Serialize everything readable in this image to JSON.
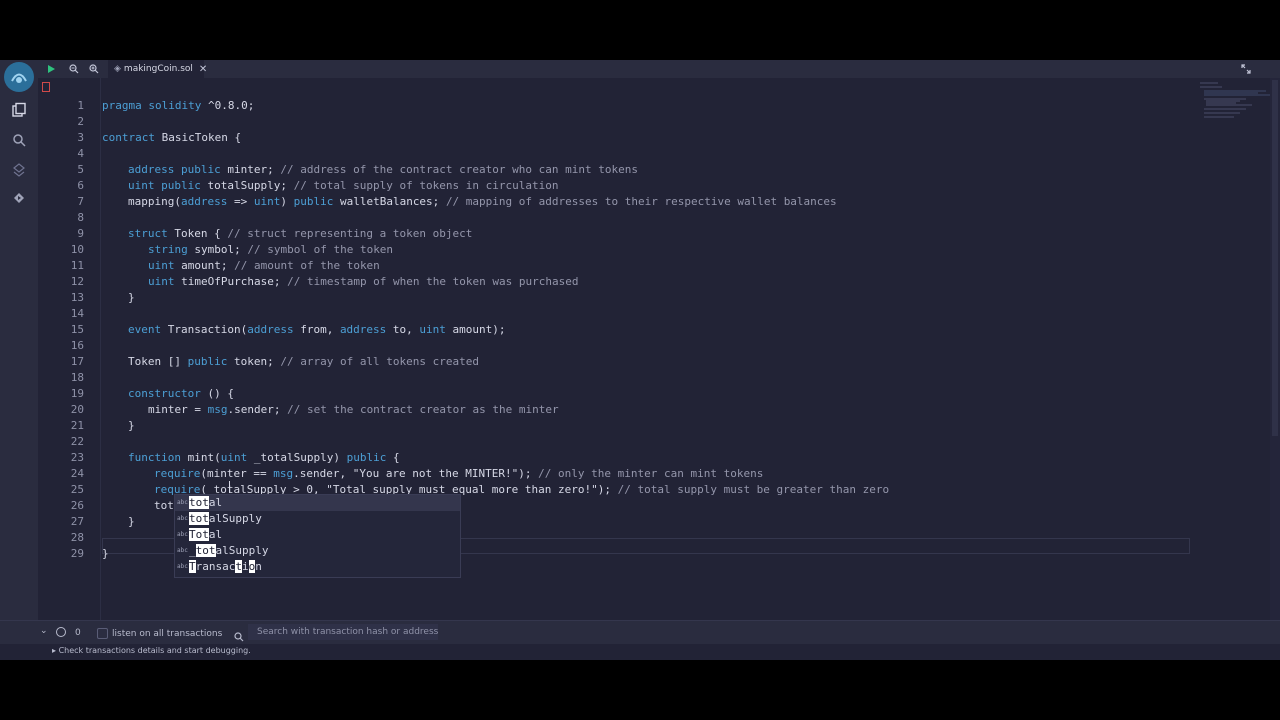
{
  "tab": {
    "filename": "makingCoin.sol",
    "close_glyph": "✕"
  },
  "line_numbers": [
    "1",
    "2",
    "3",
    "4",
    "5",
    "6",
    "7",
    "8",
    "9",
    "10",
    "11",
    "12",
    "13",
    "14",
    "15",
    "16",
    "17",
    "18",
    "19",
    "20",
    "21",
    "22",
    "23",
    "24",
    "25",
    "26",
    "27",
    "28",
    "29"
  ],
  "code": {
    "l1_kw": "pragma solidity",
    "l1_rest": " ^0.8.0;",
    "l3_kw": "contract",
    "l3_rest": " BasicToken {",
    "l5_kw": "address public",
    "l5_a": " minter; ",
    "l5_cm": "// address of the contract creator who can mint tokens",
    "l6_kw": "uint public",
    "l6_a": " totalSupply; ",
    "l6_cm": "// total supply of tokens in circulation",
    "l7_a": "mapping(",
    "l7_kw1": "address",
    "l7_b": " => ",
    "l7_kw2": "uint",
    "l7_c": ") ",
    "l7_kw3": "public",
    "l7_d": " walletBalances; ",
    "l7_cm": "// mapping of addresses to their respective wallet balances",
    "l9_kw": "struct",
    "l9_a": " Token { ",
    "l9_cm": "// struct representing a token object",
    "l10_kw": "string",
    "l10_a": " symbol; ",
    "l10_cm": "// symbol of the token",
    "l11_kw": "uint",
    "l11_a": " amount; ",
    "l11_cm": "// amount of the token",
    "l12_kw": "uint",
    "l12_a": " timeOfPurchase; ",
    "l12_cm": "// timestamp of when the token was purchased",
    "l13": "}",
    "l15_kw": "event",
    "l15_a": " Transaction(",
    "l15_kw1": "address",
    "l15_b": " from, ",
    "l15_kw2": "address",
    "l15_c": " to, ",
    "l15_kw3": "uint",
    "l15_d": " amount);",
    "l17_a": "Token [] ",
    "l17_kw": "public",
    "l17_b": " token; ",
    "l17_cm": "// array of all tokens created",
    "l19_kw": "constructor",
    "l19_a": " () {",
    "l20_a": "minter = ",
    "l20_kw": "msg",
    "l20_b": ".sender; ",
    "l20_cm": "// set the contract creator as the minter",
    "l21": "}",
    "l23_kw": "function",
    "l23_a": " mint(",
    "l23_kw1": "uint",
    "l23_b": " _totalSupply) ",
    "l23_kw2": "public",
    "l23_c": " {",
    "l24_kw": "require",
    "l24_a": "(minter == ",
    "l24_kw1": "msg",
    "l24_b": ".sender, ",
    "l24_st": "\"You are not the MINTER!\"",
    "l24_c": "); ",
    "l24_cm": "// only the minter can mint tokens",
    "l25_kw": "require",
    "l25_a": "(_totalSupply > 0, ",
    "l25_st": "\"Total supply must equal more than zero!\"",
    "l25_c": "); ",
    "l25_cm": "// total supply must be greater than zero",
    "l26": "tot",
    "l27": "}",
    "l29": "}"
  },
  "suggestions": [
    {
      "kind": "abc",
      "pre": "",
      "match": "tot",
      "post": "al"
    },
    {
      "kind": "abc",
      "pre": "",
      "match": "tot",
      "post": "alSupply"
    },
    {
      "kind": "abc",
      "pre": "",
      "match": "Tot",
      "post": "al"
    },
    {
      "kind": "abc",
      "pre": "_",
      "match": "tot",
      "post": "alSupply"
    },
    {
      "kind": "abc",
      "pre": "",
      "match": "T",
      "post": "ransac",
      "match2": "t",
      "post2": "i",
      "match3": "o",
      "post3": "n"
    }
  ],
  "terminal": {
    "count": "0",
    "listen_label": "listen on all transactions",
    "search_placeholder": "Search with transaction hash or address",
    "status_message": "Check transactions details and start debugging."
  },
  "colors": {
    "keyword": "#4c9fd5",
    "comment": "#9496ab",
    "background": "#222336",
    "panel": "#2a2c3f"
  }
}
